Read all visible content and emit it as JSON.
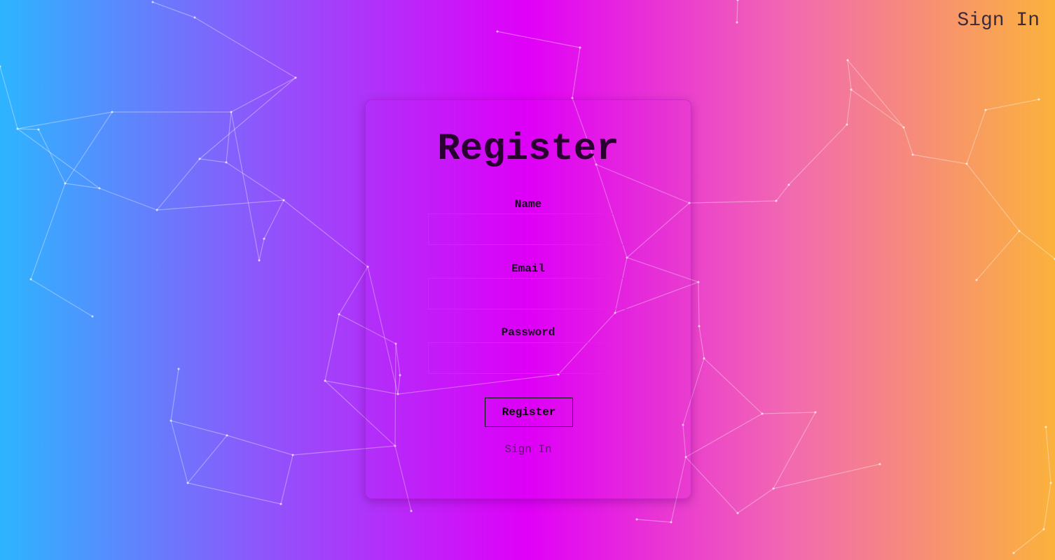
{
  "header": {
    "signin_label": "Sign In"
  },
  "form": {
    "title": "Register",
    "fields": [
      {
        "label": "Name",
        "value": ""
      },
      {
        "label": "Email",
        "value": ""
      },
      {
        "label": "Password",
        "value": ""
      }
    ],
    "submit_label": "Register",
    "signin_link": "Sign In"
  },
  "colors": {
    "gradient_left": "#2db5ff",
    "gradient_mid": "#e000f8",
    "gradient_right": "#fbb23c"
  }
}
